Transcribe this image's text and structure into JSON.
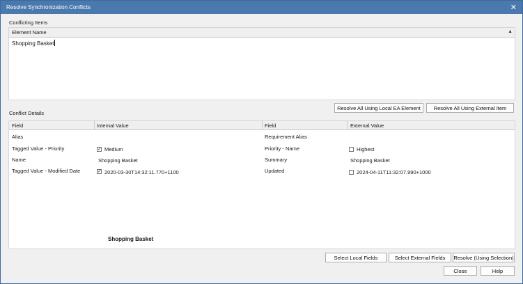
{
  "window": {
    "title": "Resolve Synchronization Conflicts",
    "close_glyph": "✕"
  },
  "conflicting_items": {
    "label": "Conflicting Items",
    "column_header": "Element Name",
    "items": [
      "Shopping Basket"
    ]
  },
  "buttons": {
    "resolve_all_local": "Resolve All Using Local EA Element",
    "resolve_all_external": "Resolve All Using External Item",
    "select_local": "Select Local Fields",
    "select_external": "Select External Fields",
    "resolve_selection": "Resolve (Using Selection)",
    "close": "Close",
    "help": "Help"
  },
  "conflict_details": {
    "label": "Conflict Details",
    "headers": {
      "field": "Field",
      "internal_value": "Internal Value",
      "field2": "Field",
      "external_value": "External Value"
    },
    "rows": [
      {
        "field": "Alias",
        "internal": "",
        "internal_checkbox": false,
        "internal_checked": false,
        "ext_field": "Requirement Alias",
        "external": "",
        "external_checkbox": false,
        "external_checked": false
      },
      {
        "field": "Tagged Value - Priority",
        "internal": "Medium",
        "internal_checkbox": true,
        "internal_checked": true,
        "ext_field": "Priority - Name",
        "external": "Highest",
        "external_checkbox": true,
        "external_checked": false
      },
      {
        "field": "Name",
        "internal": "Shopping Basket",
        "internal_checkbox": false,
        "internal_checked": false,
        "ext_field": "Summary",
        "external": "Shopping Basket",
        "external_checkbox": false,
        "external_checked": false
      },
      {
        "field": "Tagged Value - Modified Date",
        "internal": "2020-03-30T14:32:11.770+1100",
        "internal_checkbox": true,
        "internal_checked": true,
        "ext_field": "Updated",
        "external": "2024-04-11T11:32:07.990+1000",
        "external_checkbox": true,
        "external_checked": false
      }
    ],
    "selected_element": "Shopping Basket"
  }
}
